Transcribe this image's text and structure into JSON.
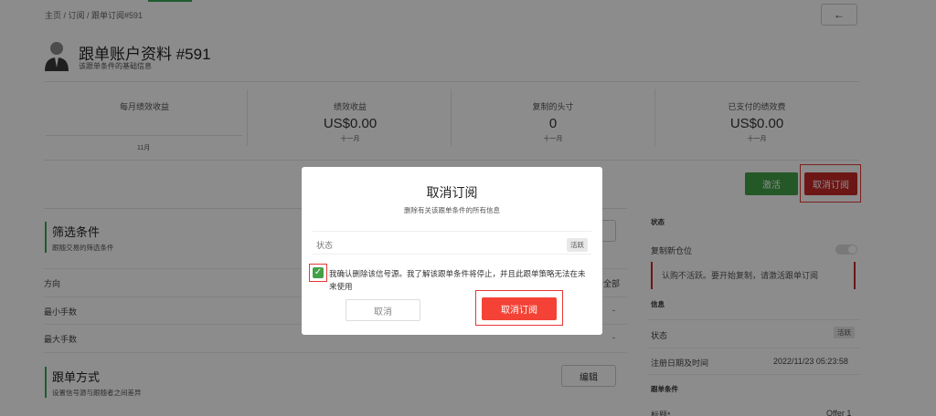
{
  "breadcrumb": "主页 / 订阅 / 跟单订阅#591",
  "back_icon": "←",
  "header": {
    "title": "跟单账户资料 #591",
    "subtitle": "该跟单条件的基础信息"
  },
  "stats": [
    {
      "label": "每月绩效收益",
      "value": "",
      "sub": ""
    },
    {
      "label": "绩效收益",
      "value": "US$0.00",
      "sub": "十一月"
    },
    {
      "label": "复制的头寸",
      "value": "0",
      "sub": "十一月"
    },
    {
      "label": "已支付的绩效费",
      "value": "US$0.00",
      "sub": "十一月"
    }
  ],
  "month_label": "11月",
  "actions": {
    "activate": "激活",
    "cancel": "取消订阅"
  },
  "filter_section": {
    "title": "筛选条件",
    "subtitle": "跟随交易的筛选条件",
    "rows": [
      {
        "label": "方向",
        "value": "全部"
      },
      {
        "label": "最小手数",
        "value": "-"
      },
      {
        "label": "最大手数",
        "value": "-"
      }
    ]
  },
  "copy_section": {
    "title": "跟单方式",
    "subtitle": "设置信号源与跟随者之间差异",
    "edit": "编辑"
  },
  "sidebar": {
    "status_head": "状态",
    "copy_new_label": "复制新仓位",
    "warning": "认购不活跃。要开始复制，请激活跟单订阅",
    "info_head": "信息",
    "status_label": "状态",
    "status_badge": "活跃",
    "reg_label": "注册日期及时间",
    "reg_value": "2022/11/23 05:23:58",
    "cond_head": "跟单条件",
    "bottom_label": "标题*",
    "bottom_value": "Offer 1"
  },
  "modal": {
    "title": "取消订阅",
    "subtitle": "删除有关该跟单条件的所有信息",
    "status_label": "状态",
    "status_badge": "活跃",
    "confirm_text": "我确认删除该信号源。我了解该跟单条件将停止，并且此跟单策略无法在未来使用",
    "cancel": "取消",
    "confirm": "取消订阅"
  },
  "colors": {
    "accent_green": "#43a047",
    "danger_red": "#f44336"
  }
}
